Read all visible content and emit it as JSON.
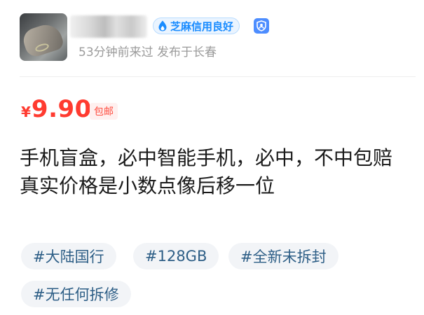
{
  "seller": {
    "credit_badge": "芝麻信用良好",
    "meta": "53分钟前来过 发布于长春"
  },
  "price": {
    "currency": "¥",
    "amount": "9.90",
    "shipping": "包邮"
  },
  "description": {
    "line1": "手机盲盒，必中智能手机，必中，不中包赔",
    "line2": "真实价格是小数点像后移一位"
  },
  "tags": [
    "#大陆国行",
    "#128GB",
    "#全新未拆封",
    "#无任何拆修"
  ],
  "colors": {
    "price_red": "#ff3b30",
    "badge_blue": "#1a8cff",
    "tag_text": "#2d5e86",
    "tag_bg": "#f2f4f7"
  }
}
